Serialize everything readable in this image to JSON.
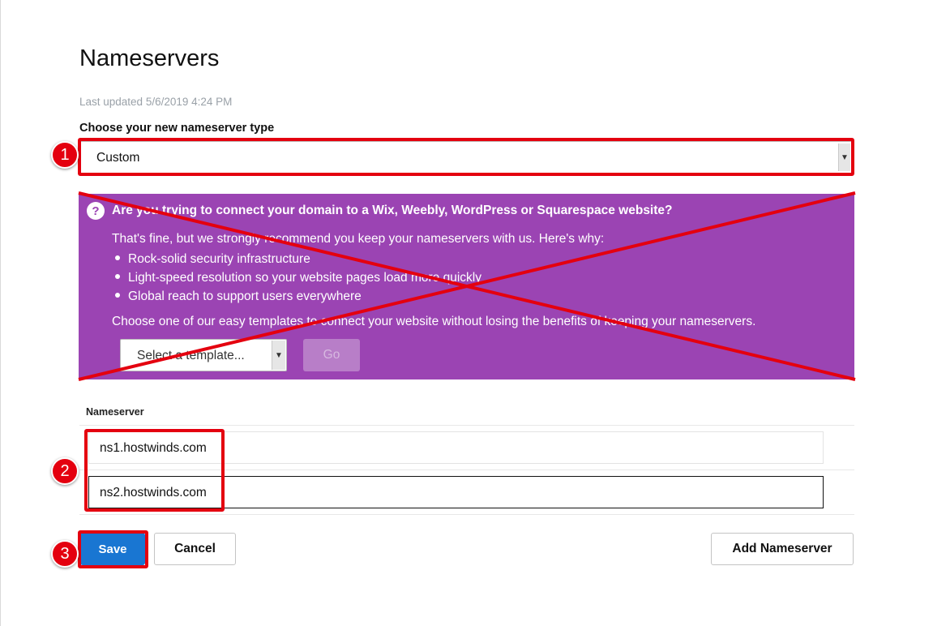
{
  "page": {
    "title": "Nameservers",
    "last_updated": "Last updated 5/6/2019 4:24 PM",
    "choose_label": "Choose your new nameserver type"
  },
  "type_select": {
    "value": "Custom"
  },
  "promo": {
    "icon": "question-circle-icon",
    "heading": "Are you trying to connect your domain to a Wix, Weebly, WordPress or Squarespace website?",
    "intro": "That's fine, but we strongly recommend you keep your nameservers with us. Here's why:",
    "reasons": [
      "Rock-solid security infrastructure",
      "Light-speed resolution so your website pages load more quickly",
      "Global reach to support users everywhere"
    ],
    "templates_text": "Choose one of our easy templates to connect your website without losing the benefits of keeping your nameservers.",
    "template_placeholder": "Select a template...",
    "go_label": "Go",
    "background": "#9b44b3"
  },
  "nameservers": {
    "header": "Nameserver",
    "items": [
      "ns1.hostwinds.com",
      "ns2.hostwinds.com"
    ]
  },
  "actions": {
    "save": "Save",
    "cancel": "Cancel",
    "add": "Add Nameserver"
  },
  "annotations": {
    "badges": [
      "1",
      "2",
      "3"
    ],
    "highlight_color": "#e4000f"
  }
}
